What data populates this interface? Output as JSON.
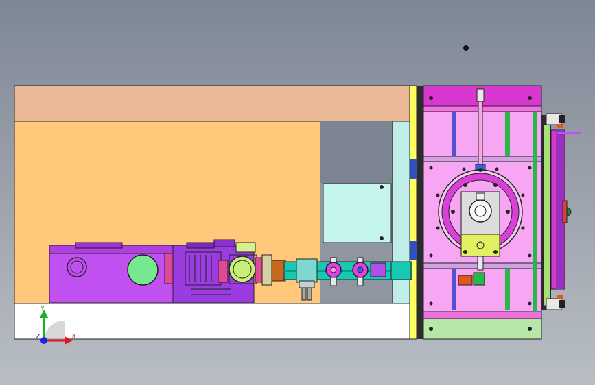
{
  "viewport": {
    "background_top": "#7e8796",
    "background_bottom": "#b9bec5"
  },
  "axis_triad": {
    "x_label": "X",
    "y_label": "Y",
    "z_label": "Z",
    "x_color": "#e8141c",
    "y_color": "#16b41e",
    "z_color": "#1c22e6"
  },
  "colors": {
    "cabinet_top": "#ebb896",
    "cabinet_body": "#ffc87a",
    "cabinet_floor": "#ffffff",
    "pump": "#c050ef",
    "motor": "#9a3ce0",
    "pipe": "#18c8b0",
    "chamber_frame": "#f7a6f3",
    "chamber_ring": "#d840d8",
    "valve_block": "#e0f060",
    "teal_panel": "#bfeee8"
  }
}
